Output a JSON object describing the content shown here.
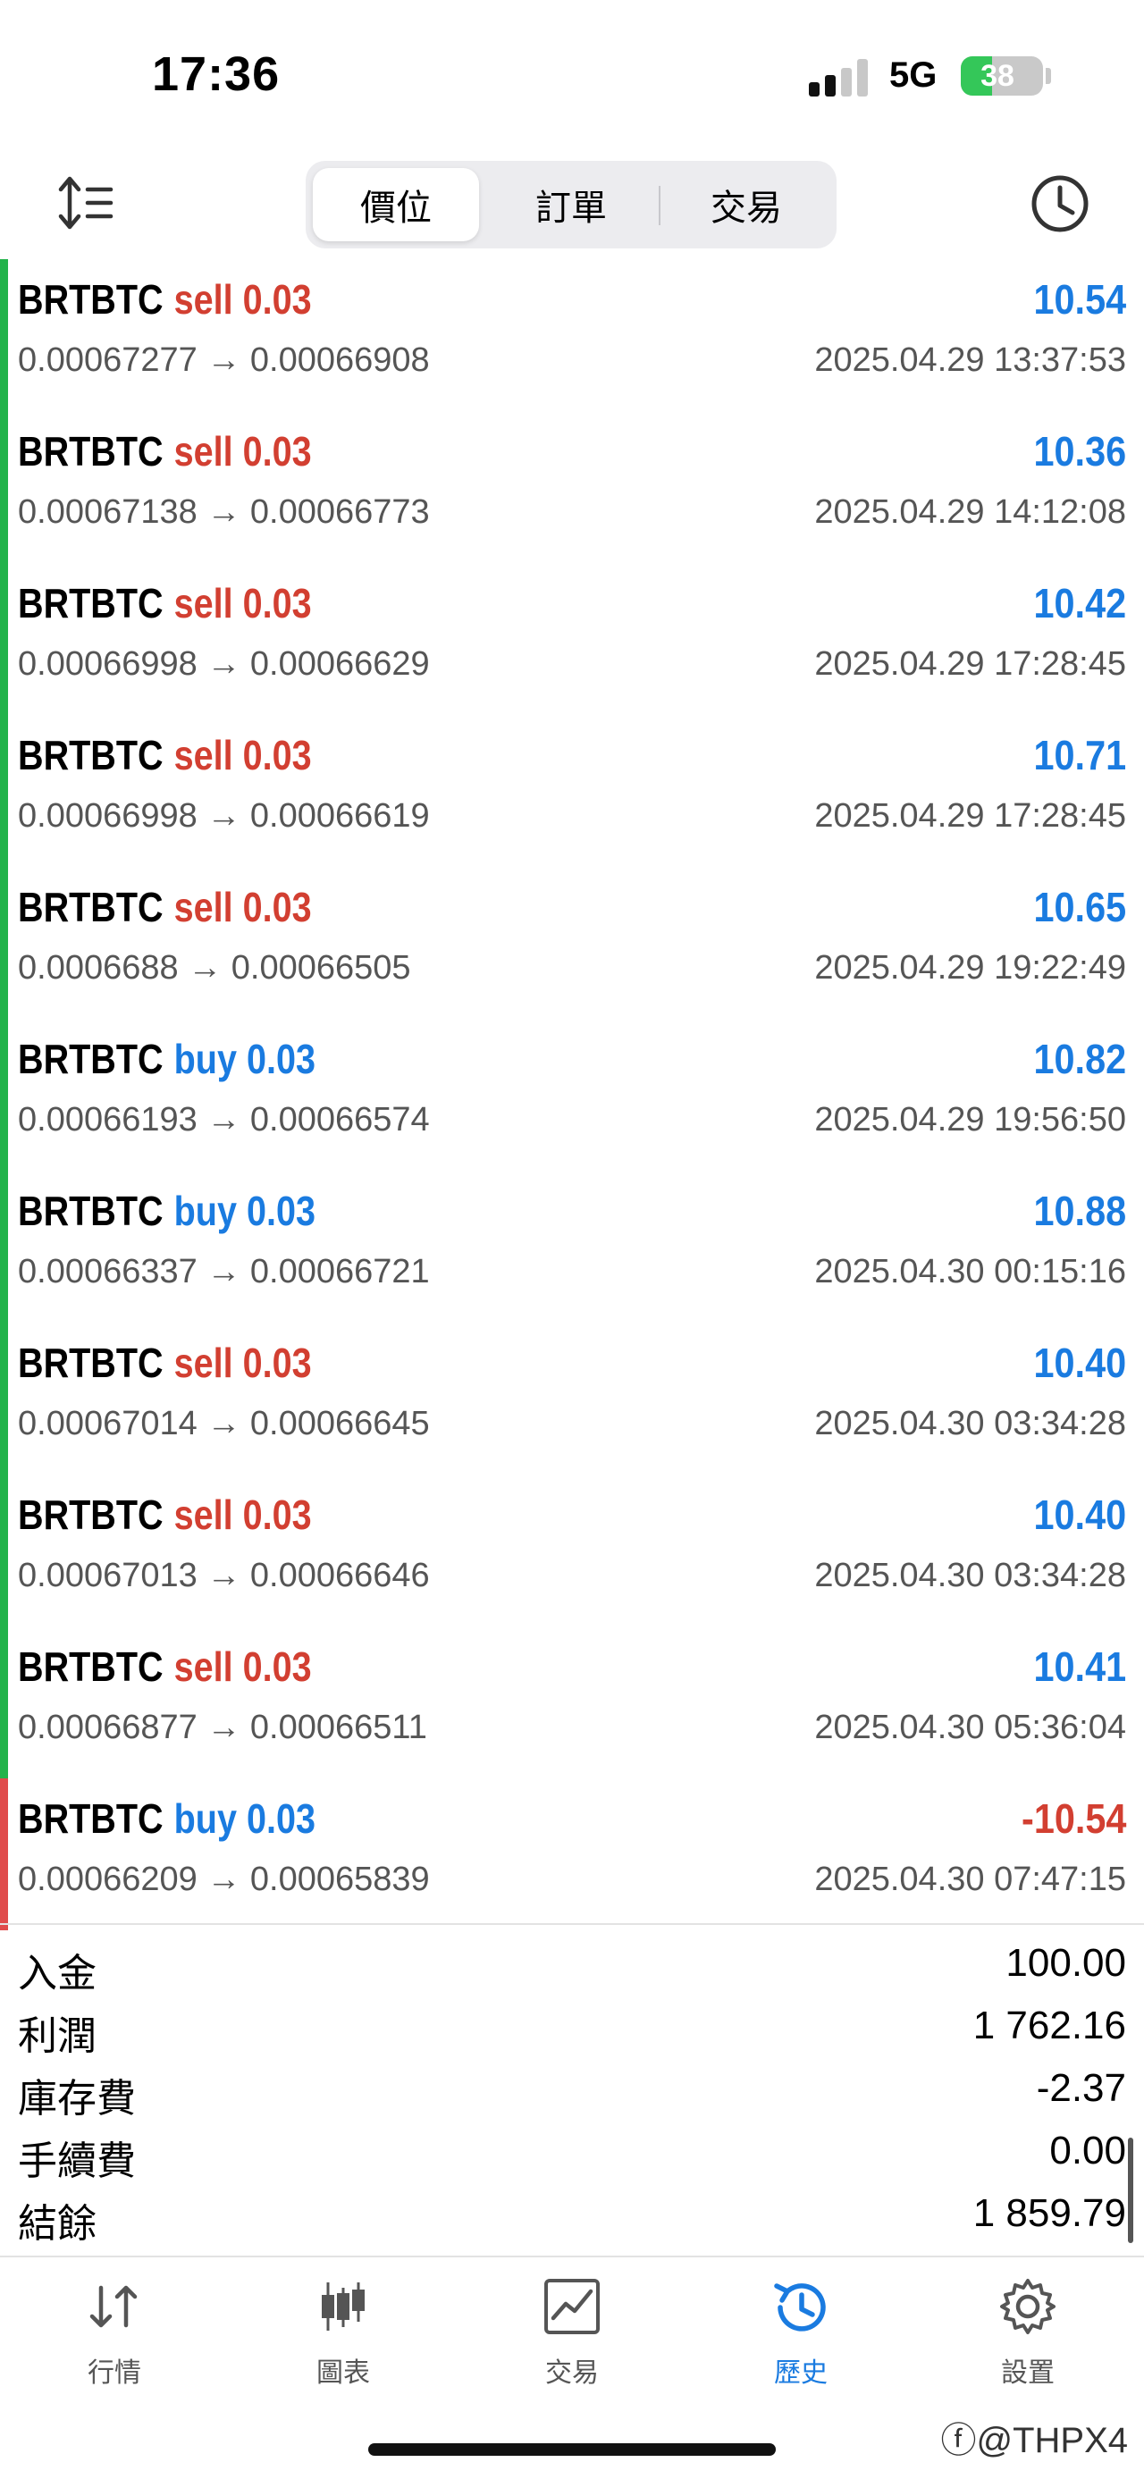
{
  "status_bar": {
    "time": "17:36",
    "network": "5G",
    "battery_percent": "38",
    "battery_level": 0.38
  },
  "toolbar": {
    "tabs": [
      {
        "label": "價位",
        "active": true
      },
      {
        "label": "訂單",
        "active": false
      },
      {
        "label": "交易",
        "active": false
      }
    ],
    "sort_icon": "sort-icon",
    "history_icon": "clock-icon"
  },
  "deals": [
    {
      "symbol": "BRTBTC",
      "type": "sell",
      "volume": "0.03",
      "profit": "10.54",
      "open_price": "0.00067277",
      "close_price": "0.00066908",
      "time": "2025.04.29 13:37:53",
      "marker_color": "#22b34a"
    },
    {
      "symbol": "BRTBTC",
      "type": "sell",
      "volume": "0.03",
      "profit": "10.36",
      "open_price": "0.00067138",
      "close_price": "0.00066773",
      "time": "2025.04.29 14:12:08",
      "marker_color": "#22b34a"
    },
    {
      "symbol": "BRTBTC",
      "type": "sell",
      "volume": "0.03",
      "profit": "10.42",
      "open_price": "0.00066998",
      "close_price": "0.00066629",
      "time": "2025.04.29 17:28:45",
      "marker_color": "#22b34a"
    },
    {
      "symbol": "BRTBTC",
      "type": "sell",
      "volume": "0.03",
      "profit": "10.71",
      "open_price": "0.00066998",
      "close_price": "0.00066619",
      "time": "2025.04.29 17:28:45",
      "marker_color": "#22b34a"
    },
    {
      "symbol": "BRTBTC",
      "type": "sell",
      "volume": "0.03",
      "profit": "10.65",
      "open_price": "0.0006688",
      "close_price": "0.00066505",
      "time": "2025.04.29 19:22:49",
      "marker_color": "#22b34a"
    },
    {
      "symbol": "BRTBTC",
      "type": "buy",
      "volume": "0.03",
      "profit": "10.82",
      "open_price": "0.00066193",
      "close_price": "0.00066574",
      "time": "2025.04.29 19:56:50",
      "marker_color": "#22b34a"
    },
    {
      "symbol": "BRTBTC",
      "type": "buy",
      "volume": "0.03",
      "profit": "10.88",
      "open_price": "0.00066337",
      "close_price": "0.00066721",
      "time": "2025.04.30 00:15:16",
      "marker_color": "#22b34a"
    },
    {
      "symbol": "BRTBTC",
      "type": "sell",
      "volume": "0.03",
      "profit": "10.40",
      "open_price": "0.00067014",
      "close_price": "0.00066645",
      "time": "2025.04.30 03:34:28",
      "marker_color": "#22b34a"
    },
    {
      "symbol": "BRTBTC",
      "type": "sell",
      "volume": "0.03",
      "profit": "10.40",
      "open_price": "0.00067013",
      "close_price": "0.00066646",
      "time": "2025.04.30 03:34:28",
      "marker_color": "#22b34a"
    },
    {
      "symbol": "BRTBTC",
      "type": "sell",
      "volume": "0.03",
      "profit": "10.41",
      "open_price": "0.00066877",
      "close_price": "0.00066511",
      "time": "2025.04.30 05:36:04",
      "marker_color": "#22b34a"
    },
    {
      "symbol": "BRTBTC",
      "type": "buy",
      "volume": "0.03",
      "profit": "-10.54",
      "open_price": "0.00066209",
      "close_price": "0.00065839",
      "time": "2025.04.30 07:47:15",
      "marker_color": "#e04b4b"
    }
  ],
  "summary": [
    {
      "label": "入金",
      "value": "100.00"
    },
    {
      "label": "利潤",
      "value": "1 762.16"
    },
    {
      "label": "庫存費",
      "value": "-2.37"
    },
    {
      "label": "手續費",
      "value": "0.00"
    },
    {
      "label": "結餘",
      "value": "1 859.79"
    }
  ],
  "tabbar": [
    {
      "label": "行情",
      "icon": "quotes-icon",
      "active": false
    },
    {
      "label": "圖表",
      "icon": "chart-icon",
      "active": false
    },
    {
      "label": "交易",
      "icon": "trade-icon",
      "active": false
    },
    {
      "label": "歷史",
      "icon": "history-icon",
      "active": true
    },
    {
      "label": "設置",
      "icon": "gear-icon",
      "active": false
    }
  ],
  "colors": {
    "sell": "#d23f31",
    "buy": "#1a7be0",
    "profit_positive": "#1a7be0",
    "profit_negative": "#d23f31",
    "active_tab": "#1a7be0"
  },
  "watermark": "ⓕ@THPX4"
}
